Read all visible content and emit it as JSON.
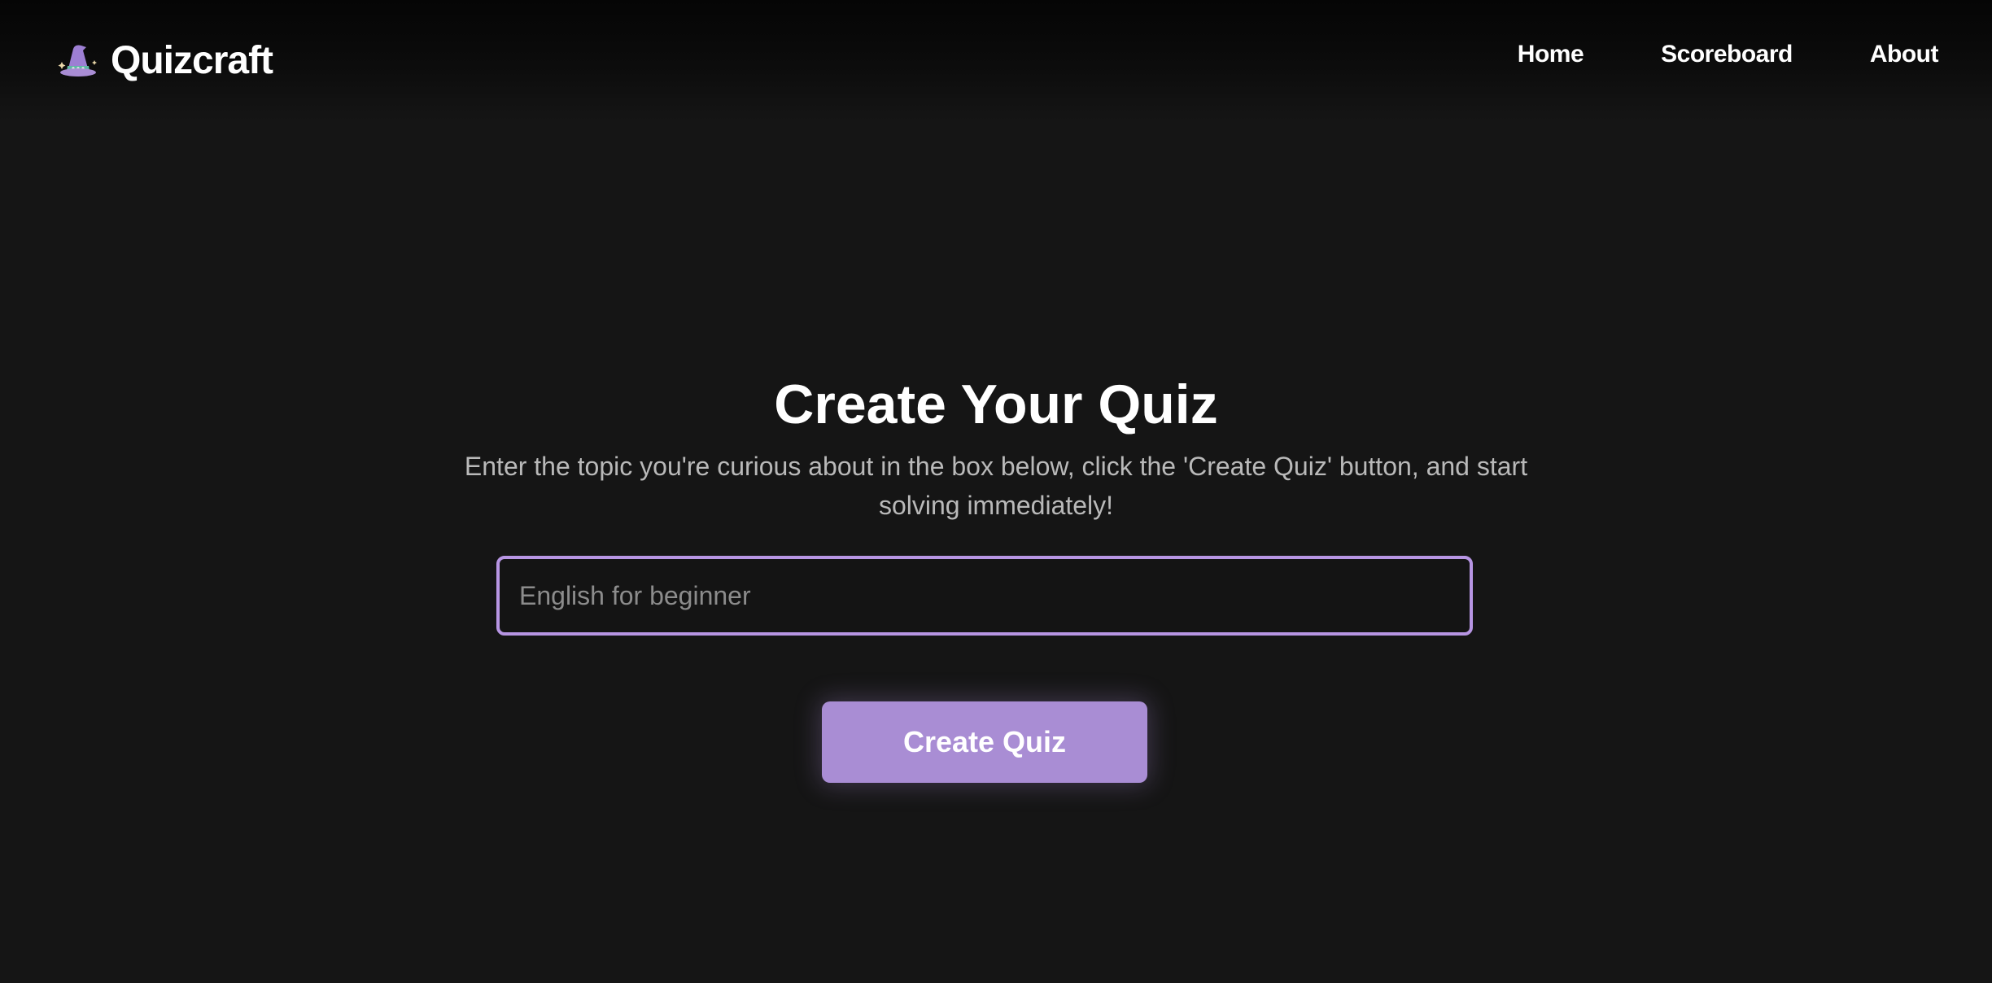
{
  "header": {
    "logo_icon": "wizard-hat-icon",
    "app_name": "Quizcraft",
    "nav": [
      {
        "label": "Home"
      },
      {
        "label": "Scoreboard"
      },
      {
        "label": "About"
      }
    ]
  },
  "main": {
    "title": "Create Your Quiz",
    "subtitle": "Enter the topic you're curious about in the box below, click the 'Create Quiz' button, and start solving immediately!",
    "topic_input": {
      "value": "",
      "placeholder": "English for beginner"
    },
    "create_button_label": "Create Quiz"
  },
  "colors": {
    "background": "#151515",
    "accent": "#a98dd4",
    "input_border": "#b795e3",
    "text_primary": "#ffffff",
    "text_secondary": "#b9b9b9"
  }
}
